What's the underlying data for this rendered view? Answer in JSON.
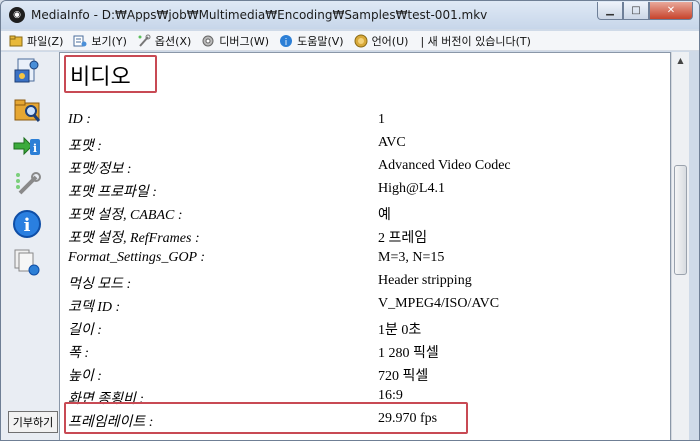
{
  "window": {
    "title": "MediaInfo - D:₩Apps₩job₩Multimedia₩Encoding₩Samples₩test-001.mkv",
    "app_icon": "speaker-icon",
    "buttons": {
      "minimize": "minimize-icon",
      "maximize": "maximize-icon",
      "close": "close-icon"
    }
  },
  "menubar": {
    "items": [
      {
        "label": "파일(Z)",
        "icon": "folder-icon"
      },
      {
        "label": "보기(Y)",
        "icon": "view-icon"
      },
      {
        "label": "옵션(X)",
        "icon": "wrench-icon"
      },
      {
        "label": "디버그(W)",
        "icon": "gear-icon"
      },
      {
        "label": "도움말(V)",
        "icon": "help-icon"
      },
      {
        "label": "언어(U)",
        "icon": "globe-icon"
      }
    ],
    "update_notice": "| 새 버전이 있습니다(T)"
  },
  "sidebar": {
    "buttons": [
      {
        "icon": "open-file-icon"
      },
      {
        "icon": "open-folder-icon"
      },
      {
        "icon": "export-info-icon"
      },
      {
        "icon": "options-icon"
      },
      {
        "icon": "about-icon"
      },
      {
        "icon": "multiple-files-icon"
      }
    ],
    "donate_label": "기부하기"
  },
  "content": {
    "section_title": "비디오",
    "rows": [
      {
        "key": "ID :",
        "value": "1"
      },
      {
        "key": "포맷 :",
        "value": "AVC"
      },
      {
        "key": "포맷/정보 :",
        "value": "Advanced Video Codec"
      },
      {
        "key": "포맷 프로파일 :",
        "value": "High@L4.1"
      },
      {
        "key": "포맷 설정, CABAC :",
        "value": "예"
      },
      {
        "key": "포맷 설정, RefFrames :",
        "value": "2 프레임"
      },
      {
        "key": "Format_Settings_GOP :",
        "value": "M=3, N=15"
      },
      {
        "key": "먹싱 모드 :",
        "value": "Header stripping"
      },
      {
        "key": "코덱 ID :",
        "value": "V_MPEG4/ISO/AVC"
      },
      {
        "key": "길이 :",
        "value": "1분 0초"
      },
      {
        "key": "폭 :",
        "value": "1 280 픽셀"
      },
      {
        "key": "높이 :",
        "value": "720 픽셀"
      },
      {
        "key": "화면 종횡비 :",
        "value": "16:9"
      },
      {
        "key": "프레임레이트 :",
        "value": "29.970 fps"
      }
    ]
  },
  "highlight_color": "#c84a54"
}
